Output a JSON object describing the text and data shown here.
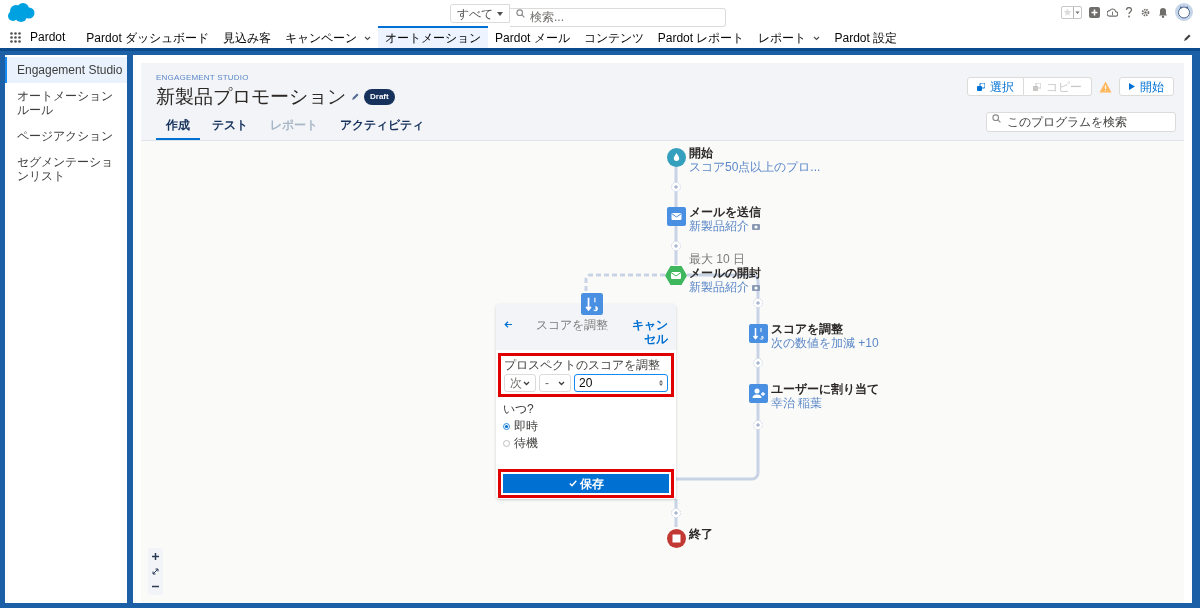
{
  "header": {
    "search_scope": "すべて",
    "search_placeholder": "検索..."
  },
  "app": {
    "name": "Pardot"
  },
  "nav_tabs": [
    {
      "label": "Pardot ダッシュボード",
      "selected": false,
      "dropdown": false
    },
    {
      "label": "見込み客",
      "selected": false,
      "dropdown": false
    },
    {
      "label": "キャンペーン",
      "selected": false,
      "dropdown": true
    },
    {
      "label": "オートメーション",
      "selected": true,
      "dropdown": false
    },
    {
      "label": "Pardot メール",
      "selected": false,
      "dropdown": false
    },
    {
      "label": "コンテンツ",
      "selected": false,
      "dropdown": false
    },
    {
      "label": "Pardot レポート",
      "selected": false,
      "dropdown": false
    },
    {
      "label": "レポート",
      "selected": false,
      "dropdown": true
    },
    {
      "label": "Pardot 設定",
      "selected": false,
      "dropdown": false
    }
  ],
  "sidebar": {
    "items": [
      {
        "label": "Engagement Studio",
        "selected": true
      },
      {
        "label": "オートメーションルール",
        "selected": false
      },
      {
        "label": "ページアクション",
        "selected": false
      },
      {
        "label": "セグメンテーションリスト",
        "selected": false
      }
    ]
  },
  "program": {
    "eyebrow": "ENGAGEMENT STUDIO",
    "title": "新製品プロモーション",
    "status": "Draft",
    "tabs": [
      {
        "label": "作成",
        "selected": true,
        "disabled": false
      },
      {
        "label": "テスト",
        "selected": false,
        "disabled": false
      },
      {
        "label": "レポート",
        "selected": false,
        "disabled": true
      },
      {
        "label": "アクティビティ",
        "selected": false,
        "disabled": false
      }
    ],
    "actions": [
      {
        "kind": "select",
        "label": "選択",
        "disabled": false
      },
      {
        "kind": "copy",
        "label": "コピー",
        "disabled": true
      },
      {
        "kind": "start",
        "label": "開始",
        "disabled": false
      }
    ],
    "search_placeholder": "このプログラムを検索"
  },
  "canvas": {
    "nodes": [
      {
        "kind": "start",
        "title": "開始",
        "subtitle": "スコア50点以上のプロ..."
      },
      {
        "kind": "email",
        "title": "メールを送信",
        "subtitle": "新製品紹介"
      },
      {
        "kind": "trigger",
        "note": "最大 10 日",
        "title": "メールの開封",
        "subtitle": "新製品紹介"
      },
      {
        "kind": "score",
        "title": "スコアを調整",
        "subtitle": "次の数値を加減 +10"
      },
      {
        "kind": "assign",
        "title": "ユーザーに割り当て",
        "subtitle": "幸治 稲葉"
      },
      {
        "kind": "end",
        "title": "終了"
      }
    ],
    "editor": {
      "title": "スコアを調整",
      "cancel": "キャンセル",
      "field_label": "プロスペクトのスコアを調整",
      "selects": [
        "次",
        "-"
      ],
      "value": "20",
      "when_label": "いつ?",
      "options": [
        {
          "label": "即時",
          "selected": true
        },
        {
          "label": "待機",
          "selected": false
        }
      ],
      "save": "保存"
    }
  }
}
